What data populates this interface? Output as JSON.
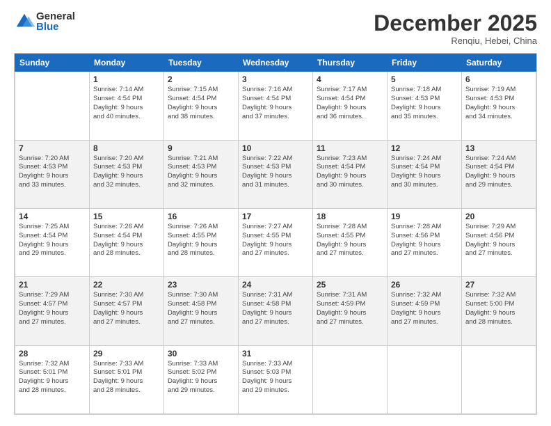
{
  "logo": {
    "general": "General",
    "blue": "Blue"
  },
  "title": "December 2025",
  "location": "Renqiu, Hebei, China",
  "days_of_week": [
    "Sunday",
    "Monday",
    "Tuesday",
    "Wednesday",
    "Thursday",
    "Friday",
    "Saturday"
  ],
  "weeks": [
    [
      {
        "day": "",
        "info": ""
      },
      {
        "day": "1",
        "info": "Sunrise: 7:14 AM\nSunset: 4:54 PM\nDaylight: 9 hours\nand 40 minutes."
      },
      {
        "day": "2",
        "info": "Sunrise: 7:15 AM\nSunset: 4:54 PM\nDaylight: 9 hours\nand 38 minutes."
      },
      {
        "day": "3",
        "info": "Sunrise: 7:16 AM\nSunset: 4:54 PM\nDaylight: 9 hours\nand 37 minutes."
      },
      {
        "day": "4",
        "info": "Sunrise: 7:17 AM\nSunset: 4:54 PM\nDaylight: 9 hours\nand 36 minutes."
      },
      {
        "day": "5",
        "info": "Sunrise: 7:18 AM\nSunset: 4:53 PM\nDaylight: 9 hours\nand 35 minutes."
      },
      {
        "day": "6",
        "info": "Sunrise: 7:19 AM\nSunset: 4:53 PM\nDaylight: 9 hours\nand 34 minutes."
      }
    ],
    [
      {
        "day": "7",
        "info": "Sunrise: 7:20 AM\nSunset: 4:53 PM\nDaylight: 9 hours\nand 33 minutes."
      },
      {
        "day": "8",
        "info": "Sunrise: 7:20 AM\nSunset: 4:53 PM\nDaylight: 9 hours\nand 32 minutes."
      },
      {
        "day": "9",
        "info": "Sunrise: 7:21 AM\nSunset: 4:53 PM\nDaylight: 9 hours\nand 32 minutes."
      },
      {
        "day": "10",
        "info": "Sunrise: 7:22 AM\nSunset: 4:53 PM\nDaylight: 9 hours\nand 31 minutes."
      },
      {
        "day": "11",
        "info": "Sunrise: 7:23 AM\nSunset: 4:54 PM\nDaylight: 9 hours\nand 30 minutes."
      },
      {
        "day": "12",
        "info": "Sunrise: 7:24 AM\nSunset: 4:54 PM\nDaylight: 9 hours\nand 30 minutes."
      },
      {
        "day": "13",
        "info": "Sunrise: 7:24 AM\nSunset: 4:54 PM\nDaylight: 9 hours\nand 29 minutes."
      }
    ],
    [
      {
        "day": "14",
        "info": "Sunrise: 7:25 AM\nSunset: 4:54 PM\nDaylight: 9 hours\nand 29 minutes."
      },
      {
        "day": "15",
        "info": "Sunrise: 7:26 AM\nSunset: 4:54 PM\nDaylight: 9 hours\nand 28 minutes."
      },
      {
        "day": "16",
        "info": "Sunrise: 7:26 AM\nSunset: 4:55 PM\nDaylight: 9 hours\nand 28 minutes."
      },
      {
        "day": "17",
        "info": "Sunrise: 7:27 AM\nSunset: 4:55 PM\nDaylight: 9 hours\nand 27 minutes."
      },
      {
        "day": "18",
        "info": "Sunrise: 7:28 AM\nSunset: 4:55 PM\nDaylight: 9 hours\nand 27 minutes."
      },
      {
        "day": "19",
        "info": "Sunrise: 7:28 AM\nSunset: 4:56 PM\nDaylight: 9 hours\nand 27 minutes."
      },
      {
        "day": "20",
        "info": "Sunrise: 7:29 AM\nSunset: 4:56 PM\nDaylight: 9 hours\nand 27 minutes."
      }
    ],
    [
      {
        "day": "21",
        "info": "Sunrise: 7:29 AM\nSunset: 4:57 PM\nDaylight: 9 hours\nand 27 minutes."
      },
      {
        "day": "22",
        "info": "Sunrise: 7:30 AM\nSunset: 4:57 PM\nDaylight: 9 hours\nand 27 minutes."
      },
      {
        "day": "23",
        "info": "Sunrise: 7:30 AM\nSunset: 4:58 PM\nDaylight: 9 hours\nand 27 minutes."
      },
      {
        "day": "24",
        "info": "Sunrise: 7:31 AM\nSunset: 4:58 PM\nDaylight: 9 hours\nand 27 minutes."
      },
      {
        "day": "25",
        "info": "Sunrise: 7:31 AM\nSunset: 4:59 PM\nDaylight: 9 hours\nand 27 minutes."
      },
      {
        "day": "26",
        "info": "Sunrise: 7:32 AM\nSunset: 4:59 PM\nDaylight: 9 hours\nand 27 minutes."
      },
      {
        "day": "27",
        "info": "Sunrise: 7:32 AM\nSunset: 5:00 PM\nDaylight: 9 hours\nand 28 minutes."
      }
    ],
    [
      {
        "day": "28",
        "info": "Sunrise: 7:32 AM\nSunset: 5:01 PM\nDaylight: 9 hours\nand 28 minutes."
      },
      {
        "day": "29",
        "info": "Sunrise: 7:33 AM\nSunset: 5:01 PM\nDaylight: 9 hours\nand 28 minutes."
      },
      {
        "day": "30",
        "info": "Sunrise: 7:33 AM\nSunset: 5:02 PM\nDaylight: 9 hours\nand 29 minutes."
      },
      {
        "day": "31",
        "info": "Sunrise: 7:33 AM\nSunset: 5:03 PM\nDaylight: 9 hours\nand 29 minutes."
      },
      {
        "day": "",
        "info": ""
      },
      {
        "day": "",
        "info": ""
      },
      {
        "day": "",
        "info": ""
      }
    ]
  ]
}
